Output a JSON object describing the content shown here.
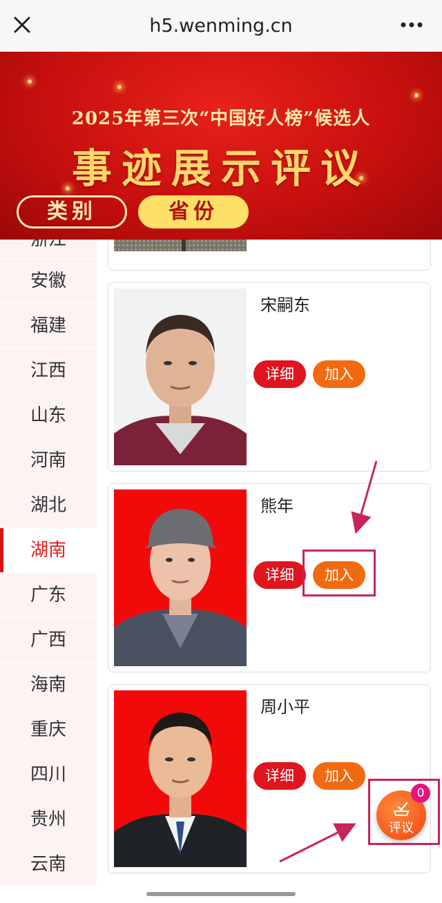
{
  "browser": {
    "url": "h5.wenming.cn"
  },
  "banner": {
    "line1": "2025年第三次“中国好人榜”候选人",
    "line2": "事迹展示评议",
    "tabs": {
      "category": "类别",
      "province": "省份"
    }
  },
  "sidebar": {
    "items": [
      "浙江",
      "安徽",
      "福建",
      "江西",
      "山东",
      "河南",
      "湖北",
      "湖南",
      "广东",
      "广西",
      "海南",
      "重庆",
      "四川",
      "贵州",
      "云南"
    ],
    "active": "湖南"
  },
  "cards": [
    {
      "name": "宋嗣东",
      "detail_label": "详细",
      "join_label": "加入"
    },
    {
      "name": "熊年",
      "detail_label": "详细",
      "join_label": "加入"
    },
    {
      "name": "周小平",
      "detail_label": "详细",
      "join_label": "加入"
    }
  ],
  "fab": {
    "label": "评议",
    "badge": "0"
  },
  "colors": {
    "primary_red": "#e0141c",
    "orange": "#f26a0f",
    "highlight": "#c8235a",
    "banner_gold": "#ffd76a"
  }
}
